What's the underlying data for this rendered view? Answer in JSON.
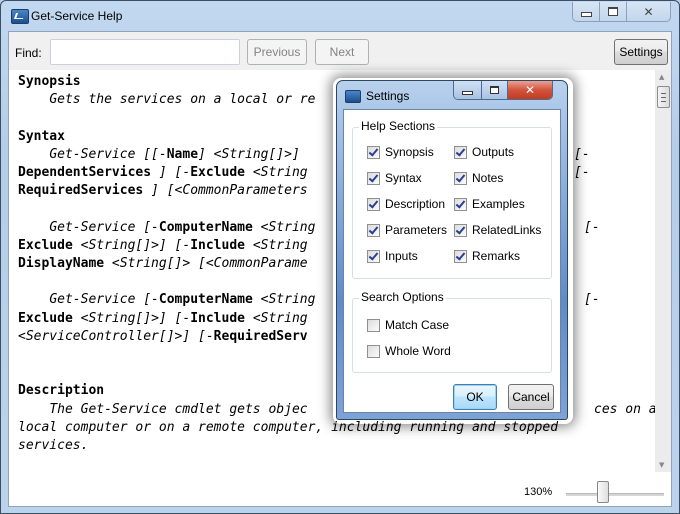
{
  "window": {
    "title": "Get-Service Help",
    "icon": "powershell-icon",
    "controls": {
      "minimize": "minimize-icon",
      "maximize": "maximize-icon",
      "close": "close-icon"
    }
  },
  "findbar": {
    "label": "Find:",
    "input_value": "",
    "previous_label": "Previous",
    "next_label": "Next",
    "settings_label": "Settings"
  },
  "help": {
    "synopsis_heading": "Synopsis",
    "synopsis_text": "Gets the services on a local or re",
    "syntax_heading": "Syntax",
    "syntax1_line1_a": "Get-Service [[-",
    "syntax1_line1_b": "Name",
    "syntax1_line1_c": "] <String[]>] ",
    "syntax1_line1_end": "[-",
    "syntax1_line2_a": "DependentServices",
    "syntax1_line2_b": " ] [-",
    "syntax1_line2_c": "Exclude",
    "syntax1_line2_d": " <String",
    "syntax1_line2_end": "[-",
    "syntax1_line3_a": "RequiredServices",
    "syntax1_line3_b": " ] [<CommonParameters",
    "syntax2_line1_a": "Get-Service [-",
    "syntax2_line1_b": "ComputerName",
    "syntax2_line1_c": " <String",
    "syntax2_line1_end": "[-",
    "syntax2_line2_a": "Exclude",
    "syntax2_line2_b": " <String[]>] [-",
    "syntax2_line2_c": "Include",
    "syntax2_line2_d": " <String",
    "syntax2_line3_a": "DisplayName",
    "syntax2_line3_b": " <String[]> [<CommonParame",
    "syntax3_line1_a": "Get-Service [-",
    "syntax3_line1_b": "ComputerName",
    "syntax3_line1_c": " <String",
    "syntax3_line1_end": "[-",
    "syntax3_line2_a": "Exclude",
    "syntax3_line2_b": " <String[]>] [-",
    "syntax3_line2_c": "Include",
    "syntax3_line2_d": " <String",
    "syntax3_line3_a": "<ServiceController[]>] [-",
    "syntax3_line3_b": "RequiredServ",
    "description_heading": "Description",
    "description_line1_a": "The Get-Service cmdlet gets objec",
    "description_line1_b": "ces on a",
    "description_line2": "local computer or on a remote computer, including running and stopped",
    "description_line3": "services."
  },
  "statusbar": {
    "zoom_label": "130%",
    "zoom_percent": 130
  },
  "settings_dialog": {
    "title": "Settings",
    "help_sections_label": "Help Sections",
    "help_sections": [
      {
        "label": "Synopsis",
        "checked": true
      },
      {
        "label": "Syntax",
        "checked": true
      },
      {
        "label": "Description",
        "checked": true
      },
      {
        "label": "Parameters",
        "checked": true
      },
      {
        "label": "Inputs",
        "checked": true
      },
      {
        "label": "Outputs",
        "checked": true
      },
      {
        "label": "Notes",
        "checked": true
      },
      {
        "label": "Examples",
        "checked": true
      },
      {
        "label": "RelatedLinks",
        "checked": true
      },
      {
        "label": "Remarks",
        "checked": true
      }
    ],
    "search_options_label": "Search Options",
    "search_options": [
      {
        "label": "Match Case",
        "checked": false
      },
      {
        "label": "Whole Word",
        "checked": false
      }
    ],
    "ok_label": "OK",
    "cancel_label": "Cancel"
  }
}
